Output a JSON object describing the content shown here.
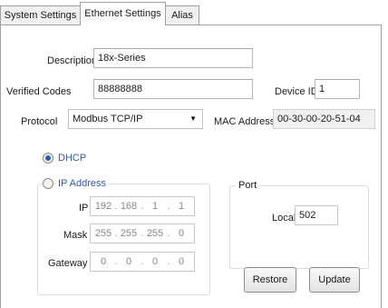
{
  "tabs": [
    {
      "label": "System Settings"
    },
    {
      "label": "Ethernet Settings"
    },
    {
      "label": "Alias"
    }
  ],
  "form": {
    "description_label": "Description",
    "description_value": "18x-Series",
    "verified_codes_label": "Verified Codes",
    "verified_codes_value": "88888888",
    "device_id_label": "Device ID",
    "device_id_value": "1",
    "protocol_label": "Protocol",
    "protocol_value": "Modbus TCP/IP",
    "mac_label": "MAC Address",
    "mac_value": "00-30-00-20-51-04"
  },
  "network": {
    "dhcp_label": "DHCP",
    "ip_address_label": "IP Address",
    "selected_mode": "DHCP",
    "ip_label": "IP",
    "ip": [
      "192",
      "168",
      "1",
      "1"
    ],
    "mask_label": "Mask",
    "mask": [
      "255",
      "255",
      "255",
      "0"
    ],
    "gateway_label": "Gateway",
    "gateway": [
      "0",
      "0",
      "0",
      "0"
    ]
  },
  "port": {
    "group_label": "Port",
    "local_label": "Local",
    "local_value": "502"
  },
  "buttons": {
    "restore": "Restore",
    "update": "Update"
  }
}
